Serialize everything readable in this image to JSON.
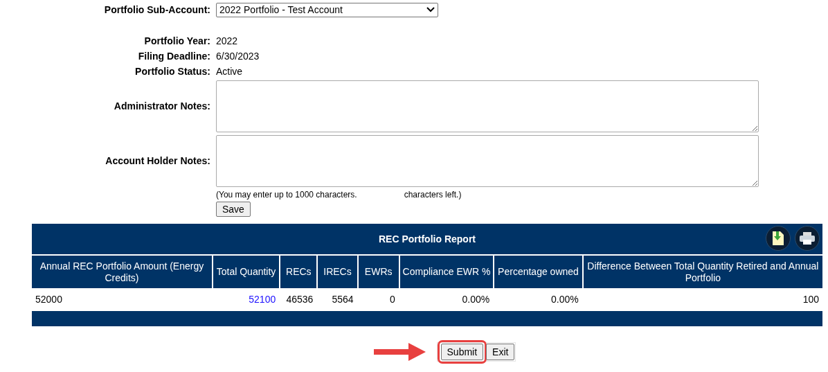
{
  "sub_account": {
    "label": "Portfolio Sub-Account:",
    "value": "2022 Portfolio - Test Account"
  },
  "info": [
    {
      "label": "Portfolio Year:",
      "value": "2022"
    },
    {
      "label": "Filing Deadline:",
      "value": "6/30/2023"
    },
    {
      "label": "Portfolio Status:",
      "value": "Active"
    }
  ],
  "notes": [
    {
      "label": "Administrator Notes:"
    },
    {
      "label": "Account Holder Notes:"
    }
  ],
  "hint": {
    "before": "(You may enter up to 1000 characters.",
    "after": "characters left.)"
  },
  "save_button": "Save",
  "report": {
    "title": "REC Portfolio Report",
    "columns": [
      "Annual REC Portfolio Amount (Energy Credits)",
      "Total Quantity",
      "RECs",
      "IRECs",
      "EWRs",
      "Compliance EWR %",
      "Percentage owned",
      "Difference Between Total Quantity Retired and Annual Portfolio"
    ],
    "rows": [
      [
        {
          "text": "52000",
          "kind": "text"
        },
        {
          "text": "52100",
          "kind": "link"
        },
        {
          "text": "46536",
          "kind": "text"
        },
        {
          "text": "5564",
          "kind": "text"
        },
        {
          "text": "0",
          "kind": "text"
        },
        {
          "text": "0.00%",
          "kind": "text"
        },
        {
          "text": "0.00%",
          "kind": "text"
        },
        {
          "text": "100",
          "kind": "text"
        }
      ]
    ]
  },
  "buttons": [
    {
      "label": "Submit",
      "highlighted": true
    },
    {
      "label": "Exit",
      "highlighted": false
    }
  ]
}
